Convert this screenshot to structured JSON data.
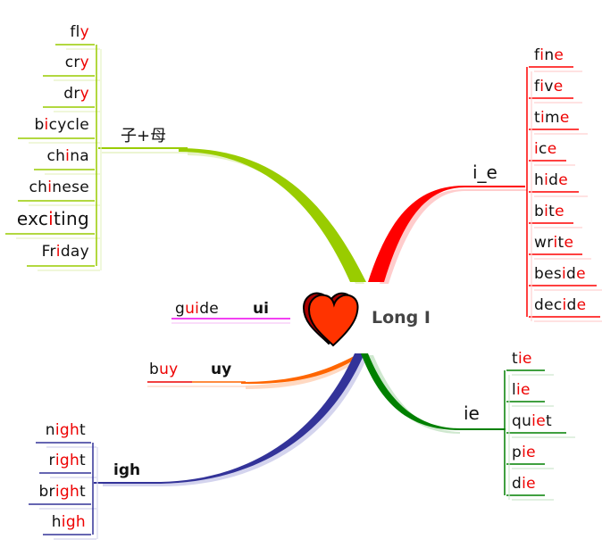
{
  "central": {
    "label": "Long I",
    "icon": "heart-icon",
    "color": "#ff3300"
  },
  "colors": {
    "highlight": "#ee0000",
    "consonant_plus_vowel": "#99cc00",
    "i_e": "#ff0000",
    "ui": "#ee00ee",
    "uy": "#ff6600",
    "igh": "#333399",
    "ie": "#008000"
  },
  "branches": {
    "consonant_plus_vowel": {
      "label": "子+母",
      "words": [
        {
          "parts": [
            [
              "fl",
              false
            ],
            [
              "y",
              true
            ]
          ]
        },
        {
          "parts": [
            [
              "cr",
              false
            ],
            [
              "y",
              true
            ]
          ]
        },
        {
          "parts": [
            [
              "dr",
              false
            ],
            [
              "y",
              true
            ]
          ]
        },
        {
          "parts": [
            [
              "b",
              false
            ],
            [
              "i",
              true
            ],
            [
              "cycle",
              false
            ]
          ]
        },
        {
          "parts": [
            [
              "ch",
              false
            ],
            [
              "i",
              true
            ],
            [
              "na",
              false
            ]
          ]
        },
        {
          "parts": [
            [
              "ch",
              false
            ],
            [
              "i",
              true
            ],
            [
              "nese",
              false
            ]
          ]
        },
        {
          "parts": [
            [
              "exc",
              false
            ],
            [
              "i",
              true
            ],
            [
              "ting",
              false
            ]
          ]
        },
        {
          "parts": [
            [
              "Fr",
              false
            ],
            [
              "i",
              true
            ],
            [
              "day",
              false
            ]
          ]
        }
      ]
    },
    "i_e": {
      "label": "i_e",
      "words": [
        {
          "parts": [
            [
              "f",
              false
            ],
            [
              "i",
              true
            ],
            [
              "n",
              false
            ],
            [
              "e",
              true
            ]
          ]
        },
        {
          "parts": [
            [
              "f",
              false
            ],
            [
              "i",
              true
            ],
            [
              "v",
              false
            ],
            [
              "e",
              true
            ]
          ]
        },
        {
          "parts": [
            [
              "t",
              false
            ],
            [
              "i",
              true
            ],
            [
              "m",
              false
            ],
            [
              "e",
              true
            ]
          ]
        },
        {
          "parts": [
            [
              "i",
              true
            ],
            [
              "c",
              false
            ],
            [
              "e",
              true
            ]
          ]
        },
        {
          "parts": [
            [
              "h",
              false
            ],
            [
              "i",
              true
            ],
            [
              "d",
              false
            ],
            [
              "e",
              true
            ]
          ]
        },
        {
          "parts": [
            [
              "b",
              false
            ],
            [
              "i",
              true
            ],
            [
              "t",
              false
            ],
            [
              "e",
              true
            ]
          ]
        },
        {
          "parts": [
            [
              "wr",
              false
            ],
            [
              "i",
              true
            ],
            [
              "t",
              false
            ],
            [
              "e",
              true
            ]
          ]
        },
        {
          "parts": [
            [
              "bes",
              false
            ],
            [
              "i",
              true
            ],
            [
              "d",
              false
            ],
            [
              "e",
              true
            ]
          ]
        },
        {
          "parts": [
            [
              "dec",
              false
            ],
            [
              "i",
              true
            ],
            [
              "d",
              false
            ],
            [
              "e",
              true
            ]
          ]
        }
      ]
    },
    "ui": {
      "label": "ui",
      "words": [
        {
          "parts": [
            [
              "g",
              false
            ],
            [
              "ui",
              true
            ],
            [
              "de",
              false
            ]
          ]
        }
      ]
    },
    "uy": {
      "label": "uy",
      "words": [
        {
          "parts": [
            [
              "b",
              false
            ],
            [
              "uy",
              true
            ]
          ]
        }
      ]
    },
    "igh": {
      "label": "igh",
      "words": [
        {
          "parts": [
            [
              "n",
              false
            ],
            [
              "igh",
              true
            ],
            [
              "t",
              false
            ]
          ]
        },
        {
          "parts": [
            [
              "r",
              false
            ],
            [
              "igh",
              true
            ],
            [
              "t",
              false
            ]
          ]
        },
        {
          "parts": [
            [
              "br",
              false
            ],
            [
              "igh",
              true
            ],
            [
              "t",
              false
            ]
          ]
        },
        {
          "parts": [
            [
              "h",
              false
            ],
            [
              "igh",
              true
            ]
          ]
        }
      ]
    },
    "ie": {
      "label": "ie",
      "words": [
        {
          "parts": [
            [
              "t",
              false
            ],
            [
              "ie",
              true
            ]
          ]
        },
        {
          "parts": [
            [
              "l",
              false
            ],
            [
              "ie",
              true
            ]
          ]
        },
        {
          "parts": [
            [
              "qu",
              false
            ],
            [
              "ie",
              true
            ],
            [
              "t",
              false
            ]
          ]
        },
        {
          "parts": [
            [
              "p",
              false
            ],
            [
              "ie",
              true
            ]
          ]
        },
        {
          "parts": [
            [
              "d",
              false
            ],
            [
              "ie",
              true
            ]
          ]
        }
      ]
    }
  }
}
